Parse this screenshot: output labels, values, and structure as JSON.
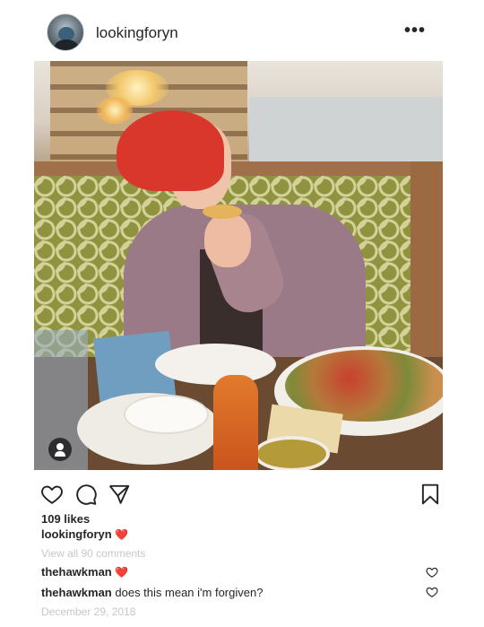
{
  "post": {
    "username": "lookingforyn",
    "more_label": "•••",
    "likes": "109 likes",
    "caption_user": "lookingforyn",
    "caption_emoji": "❤️",
    "view_comments": "View all 90 comments",
    "comments": [
      {
        "user": "thehawkman",
        "text": "❤️"
      },
      {
        "user": "thehawkman",
        "text": "does this mean i'm forgiven?"
      }
    ],
    "date": "December 29, 2018"
  },
  "icons": {
    "avatar": "profile-avatar",
    "more": "more-options-icon",
    "like": "heart-outline-icon",
    "comment": "speech-bubble-icon",
    "share": "paper-plane-icon",
    "save": "bookmark-icon",
    "user_tag": "person-icon"
  },
  "colors": {
    "text": "#262626",
    "muted": "#c7c7c7",
    "heart": "#ed1d27"
  }
}
